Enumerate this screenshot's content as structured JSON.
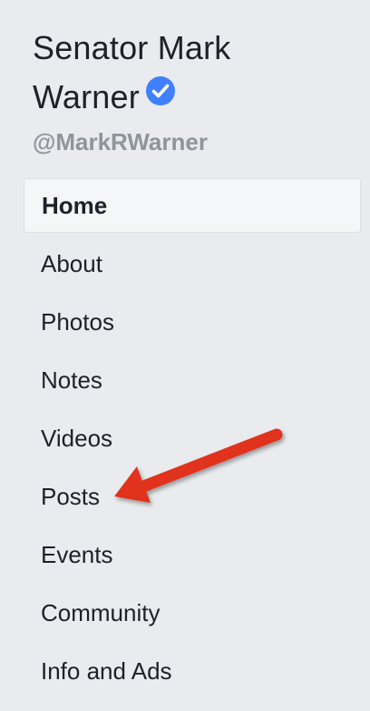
{
  "page": {
    "name_line1": "Senator Mark",
    "name_line2": "Warner",
    "handle": "@MarkRWarner"
  },
  "nav": {
    "items": [
      {
        "label": "Home",
        "active": true
      },
      {
        "label": "About"
      },
      {
        "label": "Photos"
      },
      {
        "label": "Notes"
      },
      {
        "label": "Videos"
      },
      {
        "label": "Posts"
      },
      {
        "label": "Events"
      },
      {
        "label": "Community"
      },
      {
        "label": "Info and Ads"
      }
    ]
  },
  "colors": {
    "background": "#e9ebee",
    "verified_badge": "#4080ff",
    "annotation_arrow": "#e0301e"
  }
}
